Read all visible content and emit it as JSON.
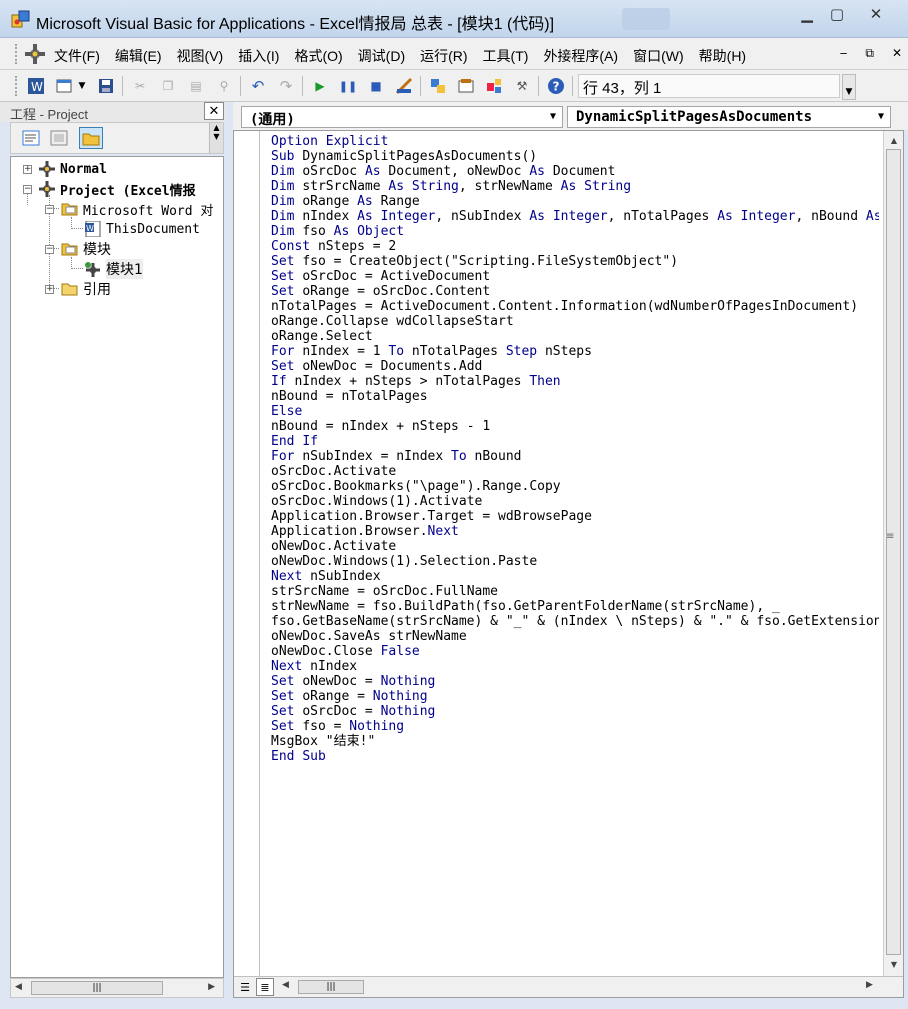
{
  "window": {
    "title": "Microsoft Visual Basic for Applications - Excel情报局 总表 - [模块1 (代码)]",
    "buttons": {
      "minimize": "▁",
      "restore": "▢",
      "close": "✕"
    },
    "app_icon": "vba-icon"
  },
  "menubar": {
    "items": [
      {
        "label": "文件(F)"
      },
      {
        "label": "编辑(E)"
      },
      {
        "label": "视图(V)"
      },
      {
        "label": "插入(I)"
      },
      {
        "label": "格式(O)"
      },
      {
        "label": "调试(D)"
      },
      {
        "label": "运行(R)"
      },
      {
        "label": "工具(T)"
      },
      {
        "label": "外接程序(A)"
      },
      {
        "label": "窗口(W)"
      },
      {
        "label": "帮助(H)"
      }
    ],
    "mdi_buttons": {
      "minimize": "‒",
      "restore": "⧉",
      "close": "✕"
    }
  },
  "toolbar": {
    "position_text": "行 43，列 1"
  },
  "project": {
    "title": "工程 - Project",
    "close": "✕",
    "tree": [
      {
        "label": "Normal",
        "expander": "+",
        "icon": "vba-project-icon"
      },
      {
        "label": "Project (Excel情报",
        "expander": "−",
        "icon": "vba-project-icon"
      },
      {
        "label": "Microsoft Word 对",
        "expander": "−",
        "icon": "folder-open-icon"
      },
      {
        "label": "ThisDocument",
        "icon": "word-document-icon"
      },
      {
        "label": "模块",
        "expander": "−",
        "icon": "folder-open-icon"
      },
      {
        "label": "模块1",
        "icon": "module-icon"
      },
      {
        "label": "引用",
        "expander": "+",
        "icon": "folder-icon"
      }
    ]
  },
  "code_window": {
    "object_combo": "(通用)",
    "procedure_combo": "DynamicSplitPagesAsDocuments",
    "keywords": [
      "Option",
      "Explicit",
      "Sub",
      "End",
      "Dim",
      "As",
      "Set",
      "Const",
      "For",
      "To",
      "Step",
      "Next",
      "If",
      "Then",
      "Else",
      "False",
      "Nothing",
      "String",
      "Integer",
      "Object"
    ],
    "lines": [
      "Option Explicit",
      "Sub DynamicSplitPagesAsDocuments()",
      "Dim oSrcDoc As Document, oNewDoc As Document",
      "Dim strSrcName As String, strNewName As String",
      "Dim oRange As Range",
      "Dim nIndex As Integer, nSubIndex As Integer, nTotalPages As Integer, nBound As Integer",
      "Dim fso As Object",
      "Const nSteps = 2",
      "Set fso = CreateObject(\"Scripting.FileSystemObject\")",
      "Set oSrcDoc = ActiveDocument",
      "Set oRange = oSrcDoc.Content",
      "nTotalPages = ActiveDocument.Content.Information(wdNumberOfPagesInDocument)",
      "oRange.Collapse wdCollapseStart",
      "oRange.Select",
      "For nIndex = 1 To nTotalPages Step nSteps",
      "Set oNewDoc = Documents.Add",
      "If nIndex + nSteps > nTotalPages Then",
      "nBound = nTotalPages",
      "Else",
      "nBound = nIndex + nSteps - 1",
      "End If",
      "For nSubIndex = nIndex To nBound",
      "oSrcDoc.Activate",
      "oSrcDoc.Bookmarks(\"\\page\").Range.Copy",
      "oSrcDoc.Windows(1).Activate",
      "Application.Browser.Target = wdBrowsePage",
      "Application.Browser.Next",
      "oNewDoc.Activate",
      "oNewDoc.Windows(1).Selection.Paste",
      "Next nSubIndex",
      "strSrcName = oSrcDoc.FullName",
      "strNewName = fso.BuildPath(fso.GetParentFolderName(strSrcName), _",
      "fso.GetBaseName(strSrcName) & \"_\" & (nIndex \\ nSteps) & \".\" & fso.GetExtensionName(strSrcName))",
      "oNewDoc.SaveAs strNewName",
      "oNewDoc.Close False",
      "Next nIndex",
      "Set oNewDoc = Nothing",
      "Set oRange = Nothing",
      "Set oSrcDoc = Nothing",
      "Set fso = Nothing",
      "MsgBox \"结束!\"",
      "End Sub"
    ]
  },
  "colors": {
    "keyword": "#00008b",
    "title_bar": "#c8d9ee",
    "chrome": "#f0f0f0"
  }
}
